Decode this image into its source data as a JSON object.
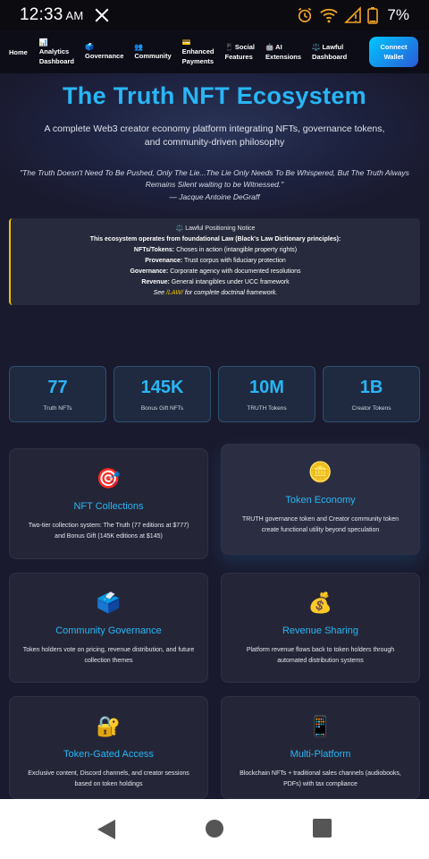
{
  "status_bar": {
    "time": "12:33",
    "ampm": "AM",
    "battery": "7%"
  },
  "navbar": {
    "home": "Home",
    "items": [
      {
        "icon": "📊",
        "line1": "Analytics",
        "line2": "Dashboard"
      },
      {
        "icon": "🗳️",
        "line1": "Governance",
        "line2": ""
      },
      {
        "icon": "👥",
        "line1": "Community",
        "line2": ""
      },
      {
        "icon": "💳",
        "line1": "Enhanced",
        "line2": "Payments"
      },
      {
        "icon": "📱",
        "line1": "Social",
        "line2": "Features"
      },
      {
        "icon": "🤖",
        "line1": "AI",
        "line2": "Extensions"
      },
      {
        "icon": "⚖️",
        "line1": "Lawful",
        "line2": "Dashboard"
      }
    ],
    "connect_line1": "Connect",
    "connect_line2": "Wallet"
  },
  "hero": {
    "title": "The Truth NFT Ecosystem",
    "subtitle": "A complete Web3 creator economy platform integrating NFTs, governance tokens, and community-driven philosophy",
    "quote": "\"The Truth Doesn't Need To Be Pushed, Only The Lie...The Lie Only Needs To Be Whispered, But The Truth Always Remains Silent waiting to be Witnessed.\"",
    "author": "— Jacque Antoine DeGraff"
  },
  "notice": {
    "title": "⚖️ Lawful Positioning Notice",
    "line1": "This ecosystem operates from foundational Law (Black's Law Dictionary principles):",
    "nfts_label": "NFTs/Tokens:",
    "nfts_text": " Choses in action (intangible property rights)",
    "provenance_label": "Provenance:",
    "provenance_text": " Trust corpus with fiduciary protection",
    "governance_label": "Governance:",
    "governance_text": " Corporate agency with documented resolutions",
    "revenue_label": "Revenue:",
    "revenue_text": " General intangibles under UCC framework",
    "see_prefix": "See ",
    "see_link": "/LAW/",
    "see_suffix": " for complete doctrinal framework."
  },
  "stats": [
    {
      "value": "77",
      "label": "Truth NFTs"
    },
    {
      "value": "145K",
      "label": "Bonus Gift NFTs"
    },
    {
      "value": "10M",
      "label": "TRUTH Tokens"
    },
    {
      "value": "1B",
      "label": "Creator Tokens"
    }
  ],
  "features": [
    {
      "icon": "🎯",
      "icon_name": "target-icon",
      "title": "NFT Collections",
      "desc": "Two-tier collection system: The Truth (77 editions at $777) and Bonus Gift (145K editions at $145)"
    },
    {
      "icon": "🪙",
      "icon_name": "coin-icon",
      "title": "Token Economy",
      "desc": "TRUTH governance token and Creator community token create functional utility beyond speculation"
    },
    {
      "icon": "🗳️",
      "icon_name": "ballot-box-icon",
      "title": "Community Governance",
      "desc": "Token holders vote on pricing, revenue distribution, and future collection themes"
    },
    {
      "icon": "💰",
      "icon_name": "money-bag-icon",
      "title": "Revenue Sharing",
      "desc": "Platform revenue flows back to token holders through automated distribution systems"
    },
    {
      "icon": "🔐",
      "icon_name": "lock-key-icon",
      "title": "Token-Gated Access",
      "desc": "Exclusive content, Discord channels, and creator sessions based on token holdings"
    },
    {
      "icon": "📱",
      "icon_name": "mobile-phone-icon",
      "title": "Multi-Platform",
      "desc": "Blockchain NFTs + traditional sales channels (audiobooks, PDFs) with tax compliance"
    }
  ]
}
